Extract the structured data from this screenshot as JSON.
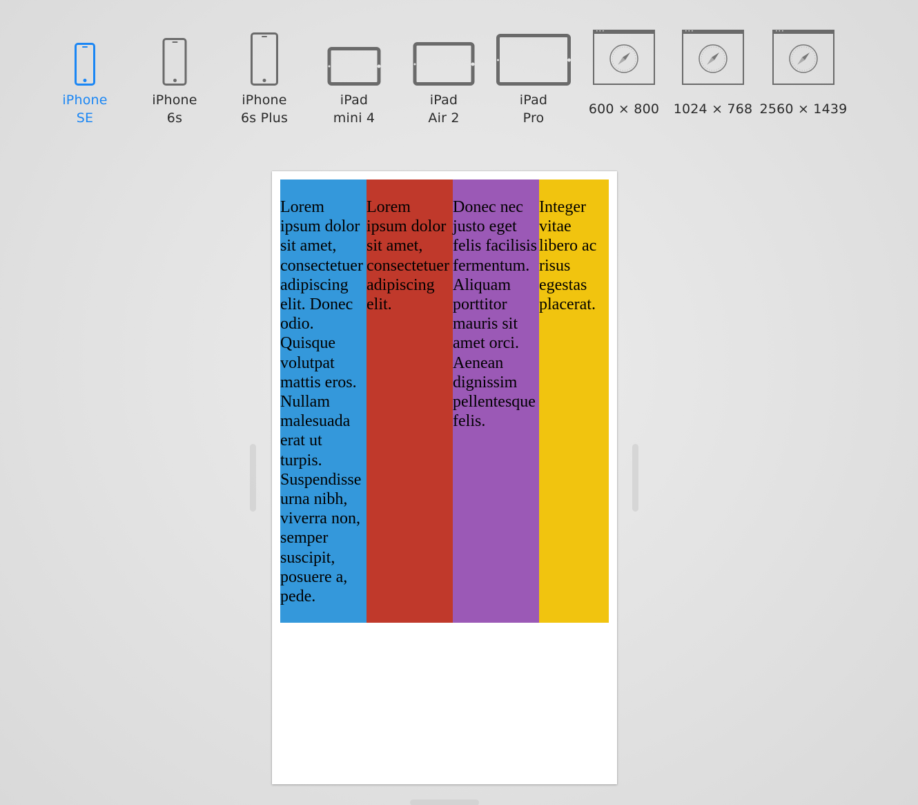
{
  "device_bar": {
    "devices": [
      {
        "id": "iphone-se",
        "line1": "iPhone",
        "line2": "SE",
        "active": true
      },
      {
        "id": "iphone-6s",
        "line1": "iPhone",
        "line2": "6s",
        "active": false
      },
      {
        "id": "iphone-6s-plus",
        "line1": "iPhone",
        "line2": "6s Plus",
        "active": false
      },
      {
        "id": "ipad-mini-4",
        "line1": "iPad",
        "line2": "mini 4",
        "active": false
      },
      {
        "id": "ipad-air-2",
        "line1": "iPad",
        "line2": "Air 2",
        "active": false
      },
      {
        "id": "ipad-pro",
        "line1": "iPad",
        "line2": "Pro",
        "active": false
      },
      {
        "id": "size-600x800",
        "label": "600 × 800",
        "active": false
      },
      {
        "id": "size-1024x768",
        "label": "1024 × 768",
        "active": false
      },
      {
        "id": "size-2560x1439",
        "label": "2560 × 1439",
        "active": false
      }
    ],
    "active_color": "#1a86f4",
    "icon_color": "#6a6a6a"
  },
  "preview": {
    "columns": [
      {
        "color": "#3498db",
        "text": "Lorem ipsum dolor sit amet, consectetuer adipiscing elit. Donec odio. Quisque volutpat mattis eros. Nullam malesuada erat ut turpis. Suspendisse urna nibh, viverra non, semper suscipit, posuere a, pede."
      },
      {
        "color": "#c0392b",
        "text": "Lorem ipsum dolor sit amet, consectetuer adipiscing elit."
      },
      {
        "color": "#9b59b6",
        "text": "Donec nec justo eget felis facilisis fermentum. Aliquam porttitor mauris sit amet orci. Aenean dignissim pellentesque felis."
      },
      {
        "color": "#f1c40f",
        "text": "Integer vitae libero ac risus egestas placerat."
      }
    ]
  }
}
